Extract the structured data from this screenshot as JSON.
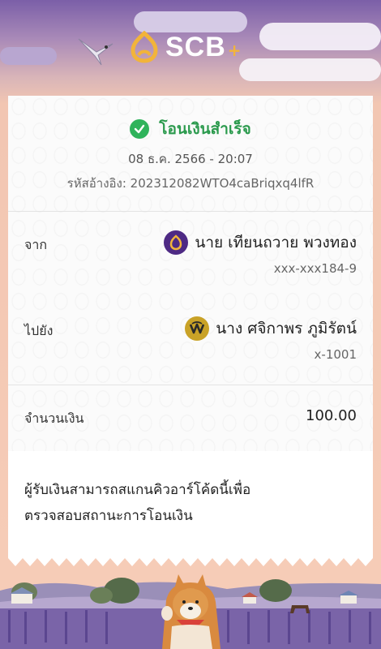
{
  "header": {
    "brand": "SCB",
    "brand_plus": "+"
  },
  "receipt": {
    "status": "โอนเงินสำเร็จ",
    "datetime": "08 ธ.ค. 2566 - 20:07",
    "reference": "รหัสอ้างอิง: 202312082WTO4caBriqxq4lfR",
    "from": {
      "label": "จาก",
      "name": "นาย เทียนถวาย พวงทอง",
      "account": "xxx-xxx184-9",
      "bank_icon": "scb-icon"
    },
    "to": {
      "label": "ไปยัง",
      "name": "นาง ศจิกาพร ภูมิรัตน์",
      "account": "x-1001",
      "bank_icon": "kbank-icon"
    },
    "amount": {
      "label": "จำนวนเงิน",
      "value": "100.00"
    },
    "note_line1": "ผู้รับเงินสามารถสแกนคิวอาร์โค้ดนี้เพื่อ",
    "note_line2": "ตรวจสอบสถานะการโอนเงิน"
  },
  "colors": {
    "scb_purple": "#4e2a84",
    "success_green": "#2fb35b",
    "kbank_gold": "#c9a227"
  }
}
